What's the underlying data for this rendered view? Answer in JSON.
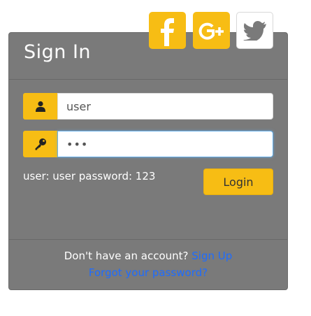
{
  "header": {
    "title": "Sign In"
  },
  "social": [
    {
      "name": "facebook",
      "icon": "facebook-icon",
      "color": "#f7bd14"
    },
    {
      "name": "google-plus",
      "icon": "google-plus-icon",
      "color": "#f7bd14"
    },
    {
      "name": "twitter",
      "icon": "twitter-icon",
      "color": "#ffffff"
    }
  ],
  "form": {
    "username": {
      "value": "user",
      "icon": "user-icon"
    },
    "password": {
      "value": "•••",
      "icon": "key-icon"
    },
    "hint": "user: user password: 123",
    "login_label": "Login"
  },
  "footer": {
    "prompt": "Don't have an account?",
    "signup_label": "Sign Up",
    "forgot_label": "Forgot your password?"
  },
  "colors": {
    "accent": "#f7bd14",
    "panel": "#7a7a7a",
    "link": "#1e6cff"
  }
}
